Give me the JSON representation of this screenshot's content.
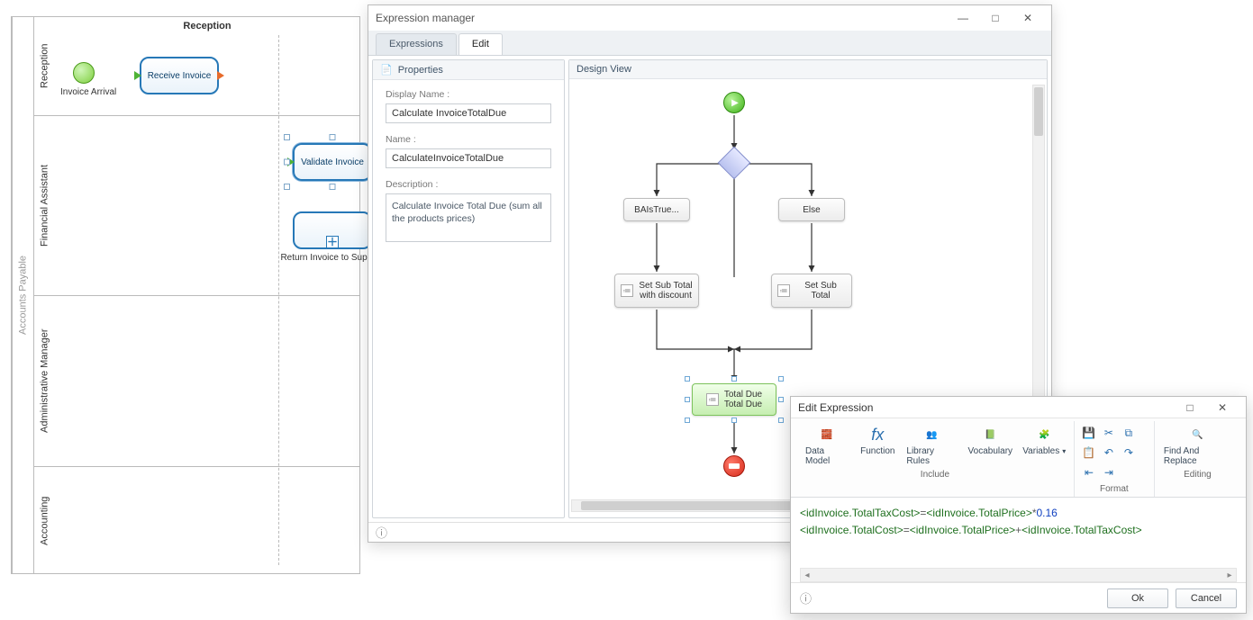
{
  "bpmn": {
    "pool_title": "Accounts Payable",
    "phase": "Reception",
    "lanes": {
      "reception": "Reception",
      "financial": "Financial Assistant",
      "admin": "Administrative Manager",
      "accounting": "Accounting"
    },
    "events": {
      "invoice_arrival": "Invoice Arrival"
    },
    "tasks": {
      "receive_invoice": "Receive Invoice",
      "validate_invoice": "Validate Invoice",
      "return_invoice": "Return Invoice to Supplier"
    }
  },
  "exp_manager": {
    "title": "Expression manager",
    "tabs": {
      "expressions": "Expressions",
      "edit": "Edit"
    },
    "panes": {
      "properties": "Properties",
      "design_view": "Design View"
    },
    "fields": {
      "display_name_label": "Display Name :",
      "display_name_value": "Calculate InvoiceTotalDue",
      "name_label": "Name :",
      "name_value": "CalculateInvoiceTotalDue",
      "description_label": "Description :",
      "description_value": "Calculate Invoice Total Due (sum all the products prices)"
    },
    "flow": {
      "ba_is_true": "BAIsTrue...",
      "else": "Else",
      "set_sub_total_discount": "Set Sub Total with discount",
      "set_sub_total": "Set Sub Total",
      "total_due_line1": "Total Due",
      "total_due_line2": "Total Due"
    }
  },
  "edit_expression": {
    "title": "Edit Expression",
    "ribbon": {
      "include": {
        "data_model": "Data Model",
        "function": "Function",
        "library_rules": "Library Rules",
        "vocabulary": "Vocabulary",
        "variables": "Variables",
        "caption": "Include"
      },
      "format": {
        "caption": "Format"
      },
      "editing": {
        "find_replace": "Find And Replace",
        "caption": "Editing"
      }
    },
    "lines": {
      "l1_p1": "<idInvoice.TotalTaxCost>",
      "l1_eq": "=",
      "l1_p2": "<idInvoice.TotalPrice>",
      "l1_mul": "*",
      "l1_num": "0.16",
      "l2_p1": "<idInvoice.TotalCost>",
      "l2_eq": "=",
      "l2_p2": "<idInvoice.TotalPrice>",
      "l2_plus": "+",
      "l2_p3": "<idInvoice.TotalTaxCost>"
    },
    "buttons": {
      "ok": "Ok",
      "cancel": "Cancel"
    }
  }
}
